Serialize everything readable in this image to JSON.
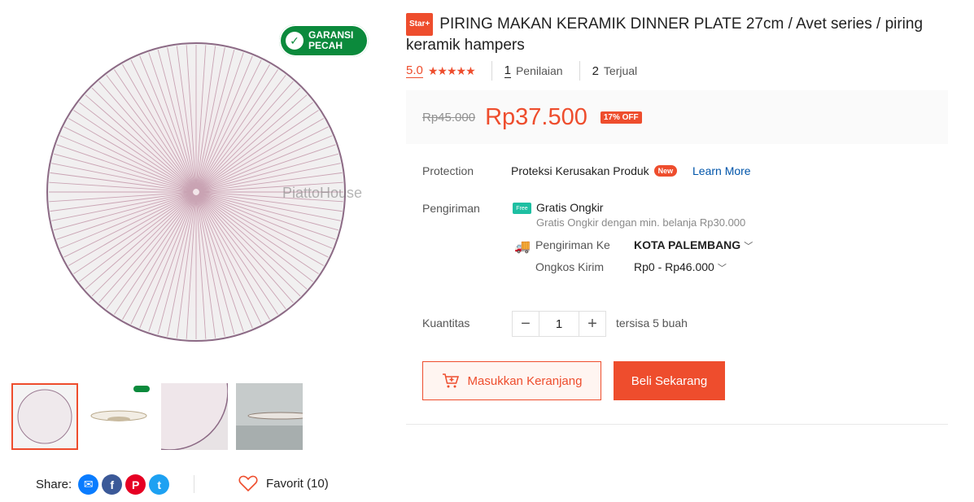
{
  "gallery": {
    "badge_line1": "GARANSI",
    "badge_line2": "PECAH",
    "watermark": "PiattoHouse",
    "thumb_count": 4
  },
  "share": {
    "label": "Share:",
    "icons": [
      "messenger-icon",
      "facebook-icon",
      "pinterest-icon",
      "twitter-icon"
    ]
  },
  "favorite": {
    "label": "Favorit (10)"
  },
  "product": {
    "star_badge": "Star+",
    "title": "PIRING MAKAN KERAMIK DINNER PLATE 27cm / Avet series / piring keramik hampers",
    "rating": "5.0",
    "stars": 5,
    "reviews_count": "1",
    "reviews_label": "Penilaian",
    "sold_count": "2",
    "sold_label": "Terjual"
  },
  "price": {
    "old": "Rp45.000",
    "new": "Rp37.500",
    "discount": "17% OFF"
  },
  "protection": {
    "label": "Protection",
    "text": "Proteksi Kerusakan Produk",
    "badge": "New",
    "link": "Learn More"
  },
  "shipping": {
    "label": "Pengiriman",
    "free_icon": "Free",
    "free_title": "Gratis Ongkir",
    "free_desc": "Gratis Ongkir dengan min. belanja Rp30.000",
    "to_label": "Pengiriman Ke",
    "to_value": "KOTA PALEMBANG",
    "cost_label": "Ongkos Kirim",
    "cost_value": "Rp0 - Rp46.000"
  },
  "quantity": {
    "label": "Kuantitas",
    "value": "1",
    "stock": "tersisa 5 buah"
  },
  "actions": {
    "cart": "Masukkan Keranjang",
    "buy": "Beli Sekarang"
  },
  "colors": {
    "accent": "#ee4d2d",
    "badge_green": "#0b8a3c",
    "link": "#0055aa"
  }
}
